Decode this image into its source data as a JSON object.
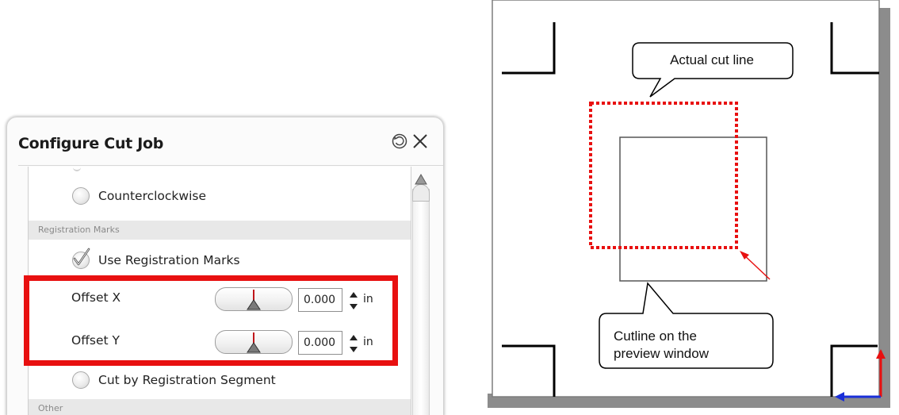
{
  "dialog": {
    "title": "Configure Cut Job",
    "radio_counterclockwise": "Counterclockwise",
    "section_registration": "Registration Marks",
    "use_registration_marks": "Use Registration Marks",
    "offset_x": {
      "label": "Offset X",
      "value": "0.000",
      "unit": "in"
    },
    "offset_y": {
      "label": "Offset Y",
      "value": "0.000",
      "unit": "in"
    },
    "cut_by_segment": "Cut by Registration Segment",
    "section_other": "Other",
    "icons": {
      "reset": "reset-icon",
      "close": "close-icon",
      "check": "check-icon",
      "spinner": "spinner-icon",
      "scroll_up": "scroll-up-icon"
    }
  },
  "preview": {
    "callout_actual": "Actual cut line",
    "callout_preview_line1": "Cutline on the",
    "callout_preview_line2": "preview window",
    "colors": {
      "actual_cut": "#e81010",
      "axis_y": "#e81010",
      "axis_x": "#1a2fd8"
    }
  }
}
